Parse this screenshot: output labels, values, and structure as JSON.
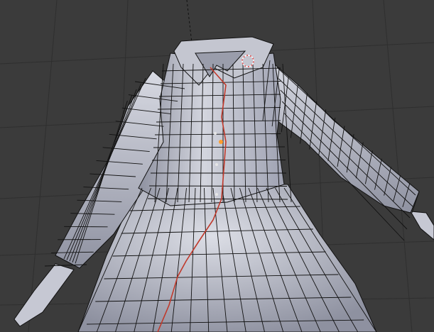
{
  "viewport": {
    "mode": "edit-mesh",
    "shading": "solid-with-wireframe",
    "background_color": "#3b3b3b",
    "grid_color": "#2f2f2f",
    "mesh_fill_color": "#c9cbd4",
    "mesh_shadow_color": "#8e91a0",
    "wire_color": "#111111",
    "seam_color": "#c0392b",
    "selected_vertex_color": "#ff9d2e",
    "cursor_circle_color": "#e14b4b"
  },
  "header": {
    "label": ""
  }
}
